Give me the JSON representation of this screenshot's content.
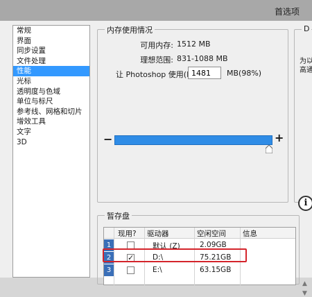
{
  "window": {
    "title": "首选项"
  },
  "sidebar": {
    "items": [
      {
        "label": "常规"
      },
      {
        "label": "界面"
      },
      {
        "label": "同步设置"
      },
      {
        "label": "文件处理"
      },
      {
        "label": "性能"
      },
      {
        "label": "光标"
      },
      {
        "label": "透明度与色域"
      },
      {
        "label": "单位与标尺"
      },
      {
        "label": "参考线、网格和切片"
      },
      {
        "label": "增效工具"
      },
      {
        "label": "文字"
      },
      {
        "label": "3D"
      }
    ],
    "selected": "性能"
  },
  "memory": {
    "legend": "内存使用情况",
    "available_label": "可用内存:",
    "available_value": "1512 MB",
    "ideal_label": "理想范围:",
    "ideal_value": "831-1088 MB",
    "use_label": "让 Photoshop 使用(L):",
    "use_value": "1481",
    "use_unit": "MB(98%)",
    "slider_fraction": 0.98,
    "minus": "−",
    "plus": "+"
  },
  "right_panel": {
    "legend": "D",
    "text_line1": "为以",
    "text_line2": "高通"
  },
  "scratch": {
    "legend": "暂存盘",
    "columns": [
      "现用?",
      "驱动器",
      "空闲空间",
      "信息"
    ],
    "rows": [
      {
        "index": "1",
        "active": false,
        "drive": "默认 (Z)",
        "free": "2.09GB",
        "info": ""
      },
      {
        "index": "2",
        "active": true,
        "drive": "D:\\",
        "free": "75.21GB",
        "info": ""
      },
      {
        "index": "3",
        "active": false,
        "drive": "E:\\",
        "free": "63.15GB",
        "info": ""
      }
    ]
  },
  "colors": {
    "selection": "#3399ff",
    "slider_fill": "#2f8ce6",
    "highlight_box": "#d4242b",
    "row_index": "#3a6fb8"
  }
}
